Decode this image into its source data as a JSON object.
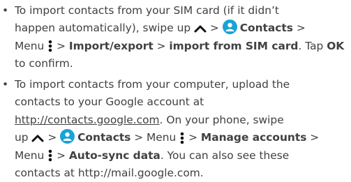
{
  "bullets": {
    "b1": {
      "l1": "To import contacts from your SIM card (if it didn’t",
      "l2_pre": "happen automatically), swipe up",
      "l2_gt": ">",
      "contacts": "Contacts",
      "gt": ">",
      "menu": "Menu",
      "import_export": "Import/export",
      "import_sim": "import from SIM card",
      "tap": "Tap",
      "ok": "OK",
      "confirm": "to confirm."
    },
    "b2": {
      "l1": "To import contacts from your computer, upload the",
      "l2": "contacts to your Google account at",
      "url": "http://contacts.google.com",
      "after_url": ". On your phone, swipe",
      "up": "up",
      "contacts": "Contacts",
      "menu": "Menu",
      "manage": "Manage accounts",
      "menu2": "Menu",
      "autosync": "Auto-sync data",
      "also": ". You can also see these",
      "last": "contacts at http://mail.google.com."
    }
  },
  "colors": {
    "text": "#414042",
    "contacts_icon": "#19a3d6"
  }
}
